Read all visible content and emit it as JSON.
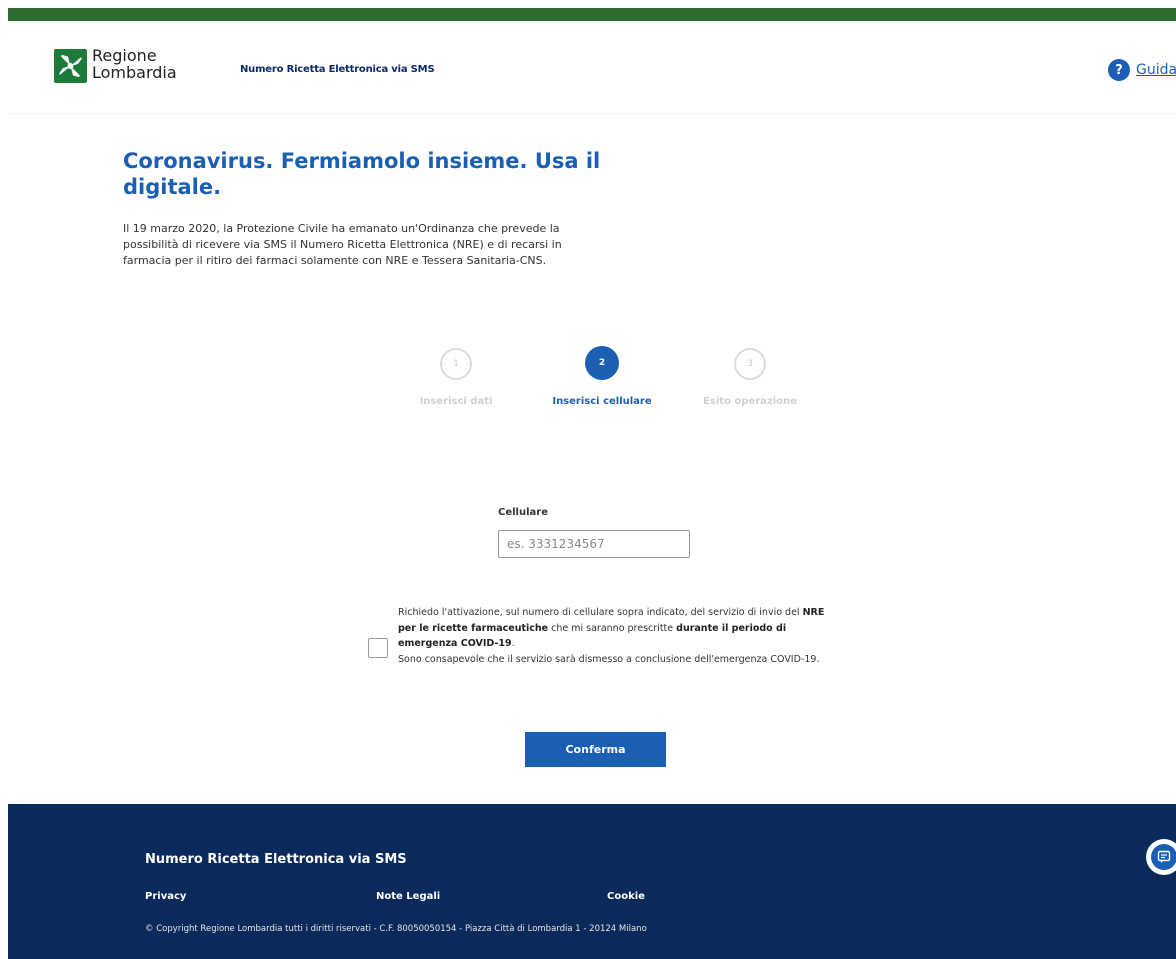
{
  "header": {
    "logo_line1": "Regione",
    "logo_line2": "Lombardia",
    "service_title": "Numero Ricetta Elettronica via SMS",
    "guide_label": "Guida",
    "guide_icon": "help-icon"
  },
  "hero": {
    "title": "Coronavirus. Fermiamolo insieme. Usa il digitale.",
    "description": "Il 19 marzo 2020, la Protezione Civile ha emanato un'Ordinanza che prevede la possibilità di ricevere via SMS il Numero Ricetta Elettronica (NRE) e di recarsi in farmacia per il ritiro dei farmaci solamente con NRE e Tessera Sanitaria-CNS."
  },
  "steps": [
    {
      "number": "1",
      "label": "Inserisci dati",
      "state": "inactive"
    },
    {
      "number": "2",
      "label": "Inserisci cellulare",
      "state": "active"
    },
    {
      "number": "3",
      "label": "Esito operazione",
      "state": "inactive"
    }
  ],
  "form": {
    "phone_label": "Cellulare",
    "phone_placeholder": "es. 3331234567",
    "phone_value": "",
    "consent_part1": "Richiedo l'attivazione, sul numero di cellulare sopra indicato, del servizio di invio del ",
    "consent_bold1": "NRE per le ricette farmaceutiche",
    "consent_part2": " che mi saranno prescritte ",
    "consent_bold2": "durante il periodo di emergenza COVID-19",
    "consent_part3": ".",
    "consent_part4": "Sono consapevole che il servizio sarà dismesso a conclusione dell'emergenza COVID-19.",
    "consent_checked": false,
    "confirm_label": "Conferma"
  },
  "footer": {
    "title": "Numero Ricetta Elettronica via SMS",
    "links": [
      "Privacy",
      "Note Legali",
      "Cookie"
    ],
    "copyright": "© Copyright Regione Lombardia tutti i diritti riservati - C.F. 80050050154 - Piazza Città di Lombardia 1 - 20124 Milano",
    "chat_icon": "chat-icon"
  },
  "colors": {
    "brand_green": "#2e6b2f",
    "logo_green": "#1c7b3a",
    "primary_blue": "#1a5fb4",
    "footer_navy": "#0b2a5c"
  }
}
